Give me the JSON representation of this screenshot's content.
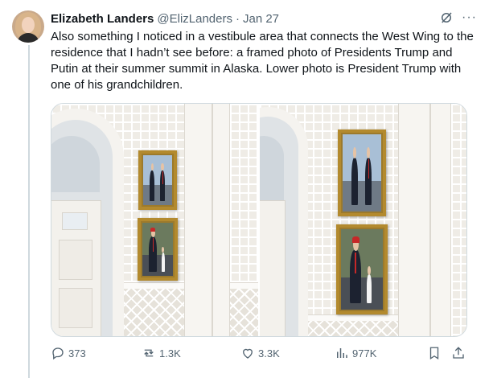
{
  "tweet": {
    "author_name": "Elizabeth Landers",
    "author_handle": "@ElizLanders",
    "separator": "·",
    "date": "Jan 27",
    "more_label": "···",
    "text": "Also something I noticed in a vestibule area that connects the West Wing to the residence that I hadn’t see before: a framed photo of Presidents Trump and Putin at their summer summit in Alaska. Lower photo is President Trump with one of his grandchildren."
  },
  "actions": {
    "replies": "373",
    "reposts": "1.3K",
    "likes": "3.3K",
    "views": "977K"
  },
  "icons": {
    "header": [
      "grok-icon",
      "more-icon"
    ],
    "actions": [
      "reply-icon",
      "repost-icon",
      "like-icon",
      "views-icon",
      "bookmark-icon",
      "share-icon"
    ]
  },
  "colors": {
    "text_primary": "#0f1419",
    "text_secondary": "#536471",
    "border": "#cfd9de",
    "frame_gold": "#b38a2e"
  }
}
